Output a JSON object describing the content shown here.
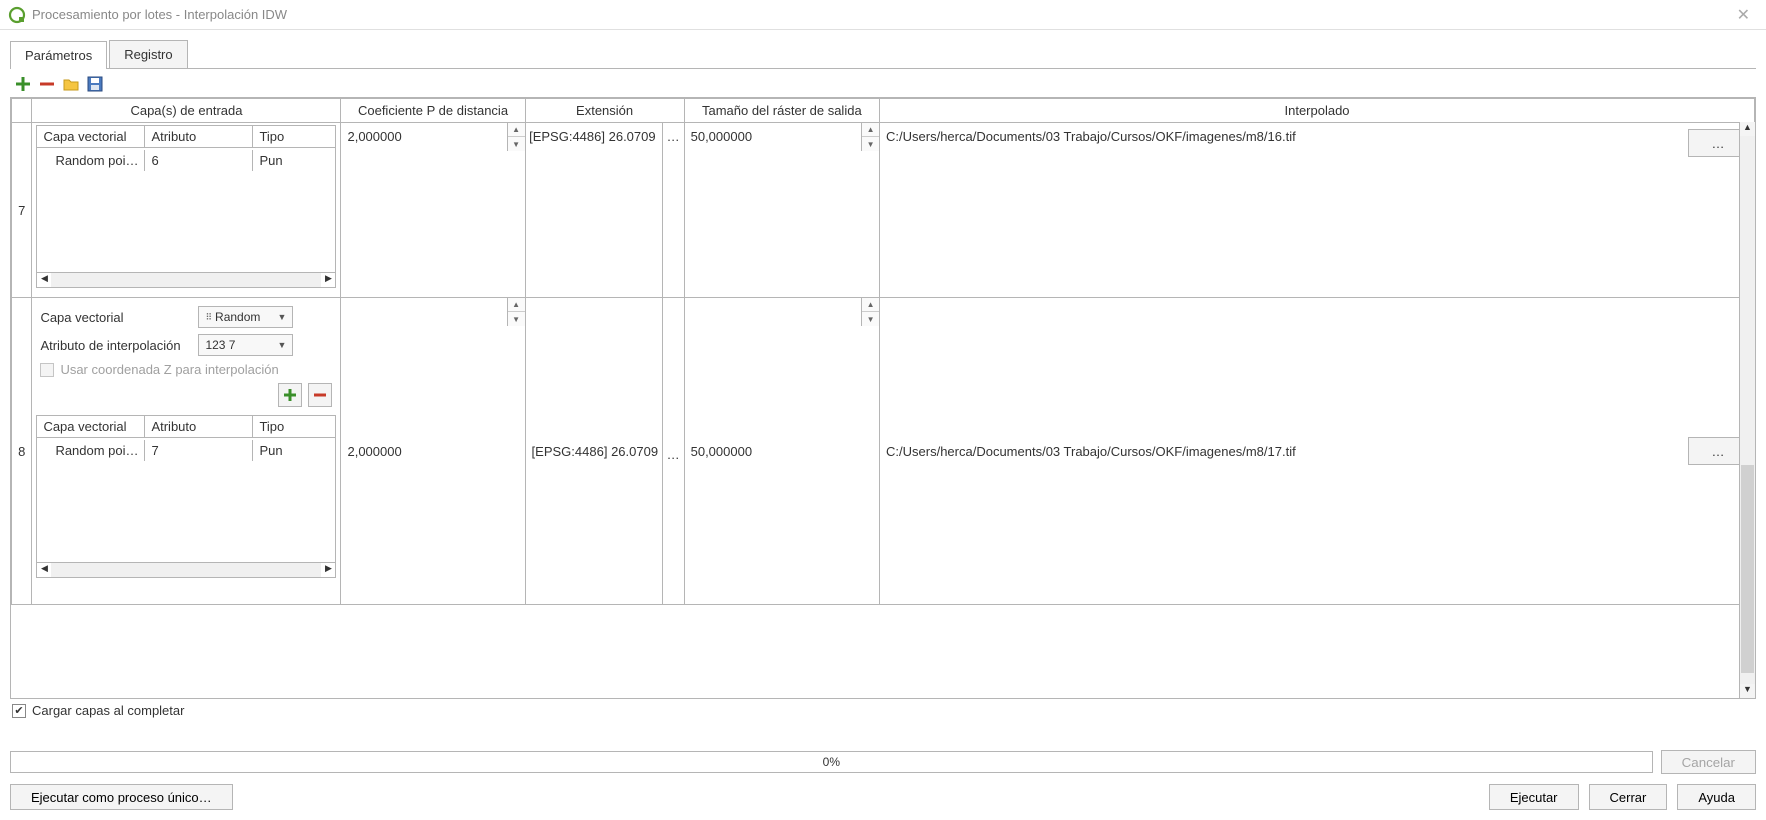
{
  "window": {
    "title": "Procesamiento por lotes - Interpolación IDW"
  },
  "tabs": {
    "parametros": "Parámetros",
    "registro": "Registro"
  },
  "columns": {
    "capas": "Capa(s) de entrada",
    "coef": "Coeficiente P de distancia",
    "ext": "Extensión",
    "tam": "Tamaño del ráster de salida",
    "interp": "Interpolado"
  },
  "inner_headers": {
    "capa": "Capa vectorial",
    "attr": "Atributo",
    "tipo": "Tipo"
  },
  "rows": [
    {
      "num": "7",
      "layer": {
        "name": "Random poi…",
        "attr": "6",
        "tipo": "Pun"
      },
      "coef": "2,000000",
      "ext": "26.0709 [EPSG:4486]",
      "tam": "50,000000",
      "path": "C:/Users/herca/Documents/03 Trabajo/Cursos/OKF/imagenes/m8/16.tif"
    },
    {
      "num": "8",
      "editor": {
        "capa_label": "Capa vectorial",
        "capa_value": "Random",
        "attr_label": "Atributo de interpolación",
        "attr_value": "123 7",
        "z_label": "Usar coordenada Z para interpolación"
      },
      "layer": {
        "name": "Random poi…",
        "attr": "7",
        "tipo": "Pun"
      },
      "coef": "2,000000",
      "ext": "26.0709 [EPSG:4486]",
      "tam": "50,000000",
      "path": "C:/Users/herca/Documents/03 Trabajo/Cursos/OKF/imagenes/m8/17.tif"
    }
  ],
  "footer": {
    "cargar": "Cargar capas al completar"
  },
  "progress": {
    "pct": "0%",
    "cancel": "Cancelar"
  },
  "buttons": {
    "run_single": "Ejecutar como proceso único…",
    "run": "Ejecutar",
    "close": "Cerrar",
    "help": "Ayuda"
  },
  "ellipsis": "…"
}
